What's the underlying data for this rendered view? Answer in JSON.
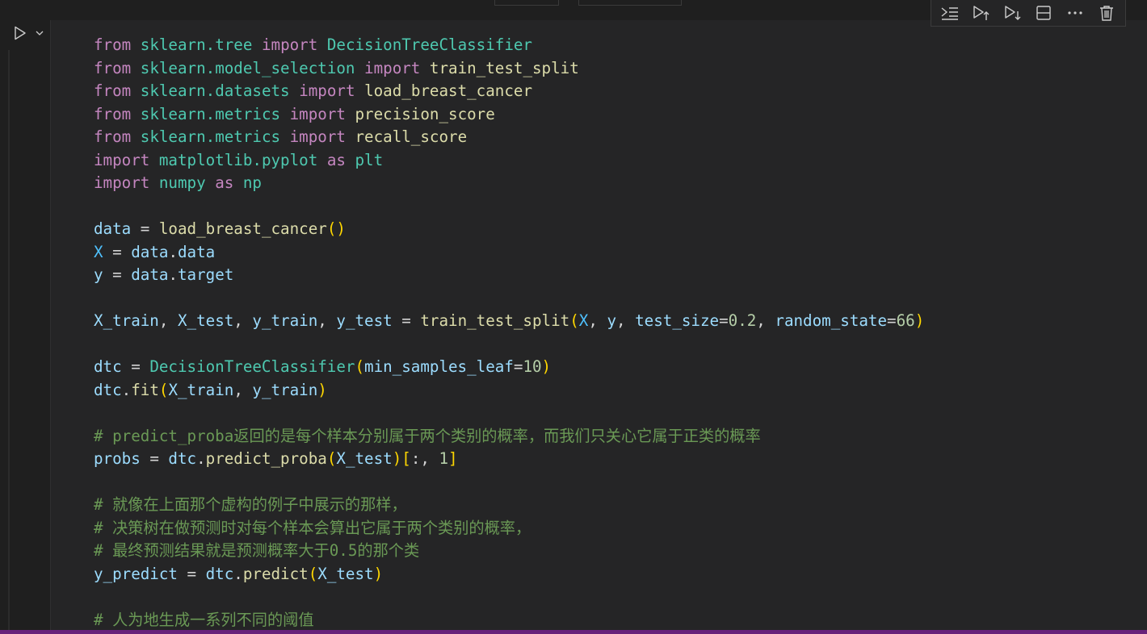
{
  "toolbar": {
    "icons": [
      "execute-above-icon",
      "run-above-icon",
      "run-below-icon",
      "split-cell-icon",
      "more-actions-icon",
      "delete-cell-icon"
    ]
  },
  "gutter": {
    "icons": [
      "run-cell-icon",
      "chevron-down-icon"
    ]
  },
  "colors": {
    "background": "#1f1f1f",
    "cell_background": "#252526",
    "keyword": "#c586c0",
    "module": "#4ec9b0",
    "function": "#dcdcaa",
    "variable": "#9cdcfe",
    "constant": "#4fc1ff",
    "number": "#b5cea8",
    "comment": "#6a9955",
    "bracket_1": "#ffd700",
    "bracket_2": "#da70d6",
    "status_bar": "#68217a"
  },
  "code": {
    "lines": [
      [
        [
          "kw",
          "from"
        ],
        [
          "op",
          " "
        ],
        [
          "mod",
          "sklearn.tree"
        ],
        [
          "op",
          " "
        ],
        [
          "kw",
          "import"
        ],
        [
          "op",
          " "
        ],
        [
          "cls",
          "DecisionTreeClassifier"
        ]
      ],
      [
        [
          "kw",
          "from"
        ],
        [
          "op",
          " "
        ],
        [
          "mod",
          "sklearn.model_selection"
        ],
        [
          "op",
          " "
        ],
        [
          "kw",
          "import"
        ],
        [
          "op",
          " "
        ],
        [
          "fn",
          "train_test_split"
        ]
      ],
      [
        [
          "kw",
          "from"
        ],
        [
          "op",
          " "
        ],
        [
          "mod",
          "sklearn.datasets"
        ],
        [
          "op",
          " "
        ],
        [
          "kw",
          "import"
        ],
        [
          "op",
          " "
        ],
        [
          "fn",
          "load_breast_cancer"
        ]
      ],
      [
        [
          "kw",
          "from"
        ],
        [
          "op",
          " "
        ],
        [
          "mod",
          "sklearn.metrics"
        ],
        [
          "op",
          " "
        ],
        [
          "kw",
          "import"
        ],
        [
          "op",
          " "
        ],
        [
          "fn",
          "precision_score"
        ]
      ],
      [
        [
          "kw",
          "from"
        ],
        [
          "op",
          " "
        ],
        [
          "mod",
          "sklearn.metrics"
        ],
        [
          "op",
          " "
        ],
        [
          "kw",
          "import"
        ],
        [
          "op",
          " "
        ],
        [
          "fn",
          "recall_score"
        ]
      ],
      [
        [
          "kw",
          "import"
        ],
        [
          "op",
          " "
        ],
        [
          "mod",
          "matplotlib.pyplot"
        ],
        [
          "op",
          " "
        ],
        [
          "kw",
          "as"
        ],
        [
          "op",
          " "
        ],
        [
          "mod",
          "plt"
        ]
      ],
      [
        [
          "kw",
          "import"
        ],
        [
          "op",
          " "
        ],
        [
          "mod",
          "numpy"
        ],
        [
          "op",
          " "
        ],
        [
          "kw",
          "as"
        ],
        [
          "op",
          " "
        ],
        [
          "mod",
          "np"
        ]
      ],
      [],
      [
        [
          "var",
          "data"
        ],
        [
          "op",
          " = "
        ],
        [
          "fn",
          "load_breast_cancer"
        ],
        [
          "p1",
          "()"
        ]
      ],
      [
        [
          "const",
          "X"
        ],
        [
          "op",
          " = "
        ],
        [
          "var",
          "data"
        ],
        [
          "op",
          "."
        ],
        [
          "var",
          "data"
        ]
      ],
      [
        [
          "var",
          "y"
        ],
        [
          "op",
          " = "
        ],
        [
          "var",
          "data"
        ],
        [
          "op",
          "."
        ],
        [
          "var",
          "target"
        ]
      ],
      [],
      [
        [
          "var",
          "X_train"
        ],
        [
          "op",
          ", "
        ],
        [
          "var",
          "X_test"
        ],
        [
          "op",
          ", "
        ],
        [
          "var",
          "y_train"
        ],
        [
          "op",
          ", "
        ],
        [
          "var",
          "y_test"
        ],
        [
          "op",
          " = "
        ],
        [
          "fn",
          "train_test_split"
        ],
        [
          "p1",
          "("
        ],
        [
          "const",
          "X"
        ],
        [
          "op",
          ", "
        ],
        [
          "var",
          "y"
        ],
        [
          "op",
          ", "
        ],
        [
          "var",
          "test_size"
        ],
        [
          "op",
          "="
        ],
        [
          "num",
          "0.2"
        ],
        [
          "op",
          ", "
        ],
        [
          "var",
          "random_state"
        ],
        [
          "op",
          "="
        ],
        [
          "num",
          "66"
        ],
        [
          "p1",
          ")"
        ]
      ],
      [],
      [
        [
          "var",
          "dtc"
        ],
        [
          "op",
          " = "
        ],
        [
          "cls",
          "DecisionTreeClassifier"
        ],
        [
          "p1",
          "("
        ],
        [
          "var",
          "min_samples_leaf"
        ],
        [
          "op",
          "="
        ],
        [
          "num",
          "10"
        ],
        [
          "p1",
          ")"
        ]
      ],
      [
        [
          "var",
          "dtc"
        ],
        [
          "op",
          "."
        ],
        [
          "fn",
          "fit"
        ],
        [
          "p1",
          "("
        ],
        [
          "var",
          "X_train"
        ],
        [
          "op",
          ", "
        ],
        [
          "var",
          "y_train"
        ],
        [
          "p1",
          ")"
        ]
      ],
      [],
      [
        [
          "cm",
          "# predict_proba返回的是每个样本分别属于两个类别的概率，而我们只关心它属于正类的概率"
        ]
      ],
      [
        [
          "var",
          "probs"
        ],
        [
          "op",
          " = "
        ],
        [
          "var",
          "dtc"
        ],
        [
          "op",
          "."
        ],
        [
          "fn",
          "predict_proba"
        ],
        [
          "p1",
          "("
        ],
        [
          "var",
          "X_test"
        ],
        [
          "p1",
          ")"
        ],
        [
          "p1",
          "["
        ],
        [
          "op",
          ":, "
        ],
        [
          "num",
          "1"
        ],
        [
          "p1",
          "]"
        ]
      ],
      [],
      [
        [
          "cm",
          "# 就像在上面那个虚构的例子中展示的那样，"
        ]
      ],
      [
        [
          "cm",
          "# 决策树在做预测时对每个样本会算出它属于两个类别的概率，"
        ]
      ],
      [
        [
          "cm",
          "# 最终预测结果就是预测概率大于0.5的那个类"
        ]
      ],
      [
        [
          "var",
          "y_predict"
        ],
        [
          "op",
          " = "
        ],
        [
          "var",
          "dtc"
        ],
        [
          "op",
          "."
        ],
        [
          "fn",
          "predict"
        ],
        [
          "p1",
          "("
        ],
        [
          "var",
          "X_test"
        ],
        [
          "p1",
          ")"
        ]
      ],
      [],
      [
        [
          "cm",
          "# 人为地生成一系列不同的阈值"
        ]
      ]
    ]
  }
}
